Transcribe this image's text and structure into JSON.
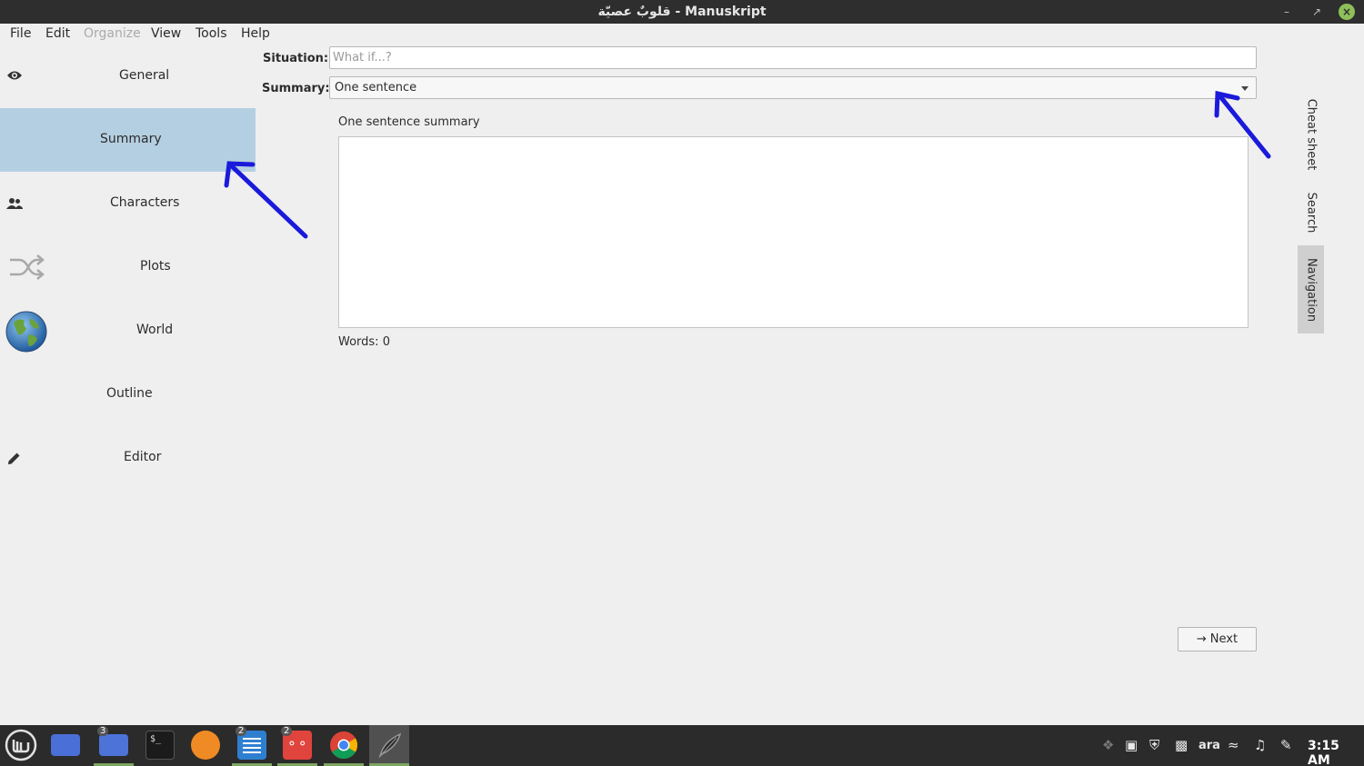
{
  "window": {
    "title": "قلوبٌ عصيّة - Manuskript"
  },
  "menu": [
    "File",
    "Edit",
    "Organize",
    "View",
    "Tools",
    "Help"
  ],
  "nav": {
    "items": [
      {
        "label": "General",
        "icon": "eye-icon"
      },
      {
        "label": "Summary",
        "icon": "",
        "selected": true
      },
      {
        "label": "Characters",
        "icon": "people-icon"
      },
      {
        "label": "Plots",
        "icon": "shuffle-icon"
      },
      {
        "label": "World",
        "icon": "globe-icon"
      },
      {
        "label": "Outline",
        "icon": ""
      },
      {
        "label": "Editor",
        "icon": "pencil-icon"
      }
    ]
  },
  "form": {
    "situation_label": "Situation:",
    "situation_placeholder": "What if...?",
    "summary_label": "Summary:",
    "summary_selected": "One sentence",
    "section_label": "One sentence summary",
    "words": "Words: 0",
    "next_label": "Next"
  },
  "side_tabs": [
    "Cheat sheet",
    "Search",
    "Navigation"
  ],
  "active_side_tab": "Navigation",
  "taskbar": {
    "badges": {
      "files": "3",
      "text_editor": "2",
      "reader": "2"
    },
    "language": "ara",
    "clock": "3:15 AM"
  },
  "colors": {
    "selection": "#b5cfe2",
    "annotation_arrow": "#1a1adb",
    "taskbar": "#2b2b2b",
    "active_underline": "#7ea661"
  }
}
